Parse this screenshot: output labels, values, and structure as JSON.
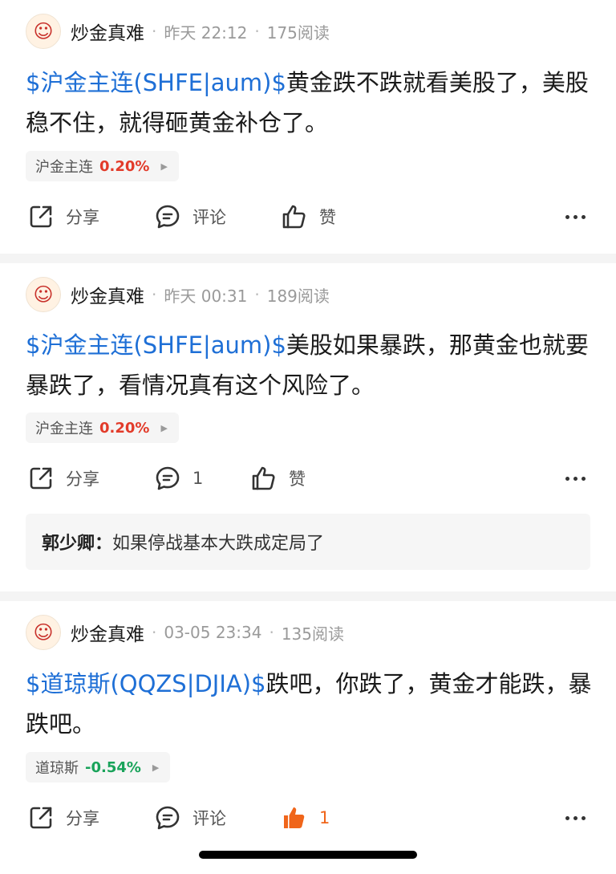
{
  "posts": [
    {
      "author": "炒金真难",
      "time": "昨天 22:12",
      "reads": "175阅读",
      "tag": "$沪金主连(SHFE|aum)$",
      "text": "黄金跌不跌就看美股了，美股稳不住，就得砸黄金补仓了。",
      "stock": {
        "name": "沪金主连",
        "change": "0.20%",
        "direction": "up"
      },
      "actions": {
        "share": "分享",
        "comment": "评论",
        "like": "赞"
      }
    },
    {
      "author": "炒金真难",
      "time": "昨天 00:31",
      "reads": "189阅读",
      "tag": "$沪金主连(SHFE|aum)$",
      "text": "美股如果暴跌，那黄金也就要暴跌了，看情况真有这个风险了。",
      "stock": {
        "name": "沪金主连",
        "change": "0.20%",
        "direction": "up"
      },
      "actions": {
        "share": "分享",
        "comment": "1",
        "like": "赞"
      },
      "reply": {
        "name": "郭少卿：",
        "text": "如果停战基本大跌成定局了"
      }
    },
    {
      "author": "炒金真难",
      "time": "03-05 23:34",
      "reads": "135阅读",
      "tag": "$道琼斯(QQZS|DJIA)$",
      "text": "跌吧，你跌了，黄金才能跌，暴跌吧。",
      "stock": {
        "name": "道琼斯",
        "change": "-0.54%",
        "direction": "down"
      },
      "actions": {
        "share": "分享",
        "comment": "评论",
        "like": "1",
        "liked": true
      }
    }
  ],
  "sep": "·",
  "colors": {
    "link": "#1e6fd6",
    "up": "#e23b2a",
    "down": "#19a35a",
    "liked": "#f0651a"
  },
  "icons": {
    "avatar": "fortune-god-avatar-icon",
    "share": "share-icon",
    "comment": "comment-icon",
    "like": "thumbs-up-icon",
    "more": "more-dots-icon"
  }
}
